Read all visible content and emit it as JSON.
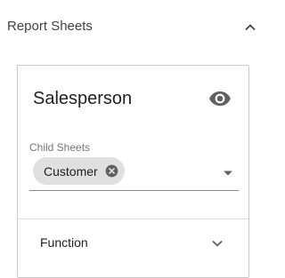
{
  "section": {
    "title": "Report Sheets",
    "collapse_icon": "chevron-up-icon"
  },
  "card": {
    "title": "Salesperson",
    "visibility_icon": "eye-icon",
    "child_sheets": {
      "label": "Child Sheets",
      "chips": [
        {
          "label": "Customer",
          "remove_icon": "close-circle-icon"
        }
      ],
      "dropdown_icon": "caret-down-icon"
    },
    "function": {
      "label": "Function",
      "expand_icon": "chevron-down-icon"
    }
  },
  "colors": {
    "text_primary": "#212121",
    "text_secondary": "#757575",
    "chip_background": "#e0e0e0",
    "icon": "#616161",
    "card_border": "#c9c9c9"
  }
}
